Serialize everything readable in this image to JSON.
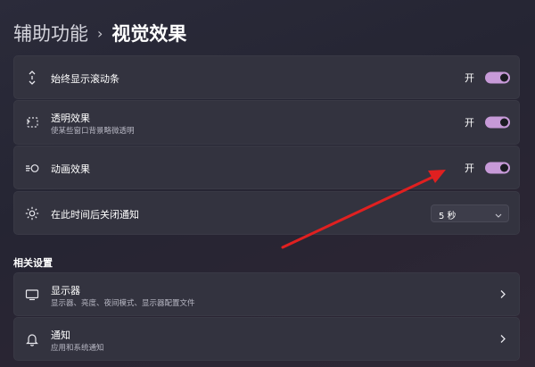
{
  "breadcrumb": {
    "parent": "辅助功能",
    "separator": "›",
    "current": "视觉效果"
  },
  "settings": [
    {
      "label": "始终显示滚动条",
      "state": "开",
      "on": true,
      "icon": "scrollbar-icon"
    },
    {
      "label": "透明效果",
      "sub": "使某些窗口背景略微透明",
      "state": "开",
      "on": true,
      "icon": "transparency-icon"
    },
    {
      "label": "动画效果",
      "state": "开",
      "on": true,
      "icon": "animation-icon"
    },
    {
      "label": "在此时间后关闭通知",
      "value": "5 秒",
      "icon": "brightness-icon"
    }
  ],
  "related": {
    "title": "相关设置",
    "items": [
      {
        "label": "显示器",
        "sub": "显示器、亮度、夜间模式、显示器配置文件",
        "icon": "monitor-icon"
      },
      {
        "label": "通知",
        "sub": "应用和系统通知",
        "icon": "bell-icon"
      }
    ]
  },
  "colors": {
    "accent": "#c79ad8",
    "annotation_arrow": "#e02020",
    "card": "#33333f"
  }
}
